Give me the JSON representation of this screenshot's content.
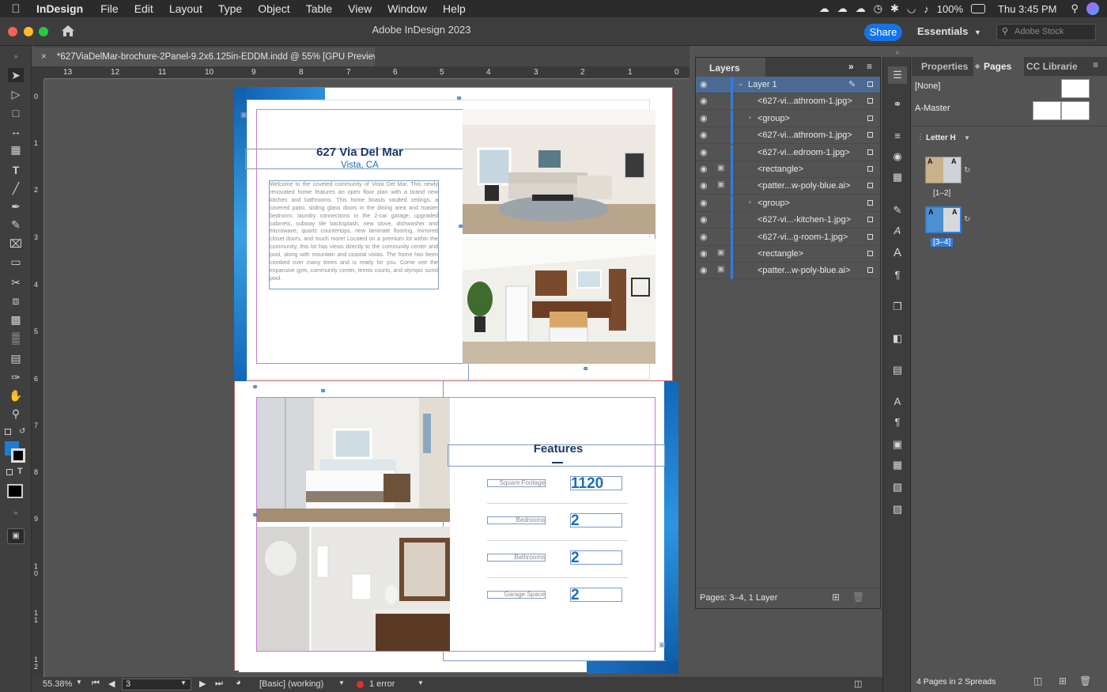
{
  "menubar": {
    "app_name": "InDesign",
    "items": [
      "File",
      "Edit",
      "Layout",
      "Type",
      "Object",
      "Table",
      "View",
      "Window",
      "Help"
    ],
    "battery": "100%",
    "clock": "Thu 3:45 PM"
  },
  "appbar": {
    "title": "Adobe InDesign 2023",
    "share_label": "Share",
    "workspace": "Essentials",
    "stock_placeholder": "Adobe Stock"
  },
  "document": {
    "tab_title": "*627ViaDelMar-brochure-2Panel-9.2x6.125in-EDDM.indd @ 55% [GPU Preview]",
    "close_glyph": "×"
  },
  "rulers": {
    "horizontal": [
      "13",
      "12",
      "11",
      "10",
      "9",
      "8",
      "7",
      "6",
      "5",
      "4",
      "3",
      "2",
      "1",
      "0"
    ],
    "vertical": [
      "0",
      "1",
      "2",
      "3",
      "4",
      "5",
      "6",
      "7",
      "8",
      "9",
      "1 0",
      "1 1",
      "1 2"
    ]
  },
  "brochure": {
    "title": "627 Via Del Mar",
    "subtitle": "Vista, CA",
    "body": "Welcome to the coveted community of Vista Del Mar. This newly renovated home features an open floor plan with a brand new kitchen and bathrooms. This home boasts vaulted ceilings, a covered patio, sliding glass doors in the dining area and master bedroom, laundry connections in the 2-car garage, upgraded cabinets, subway tile backsplash, new stove, dishwasher and microwave, quartz countertops, new laminate flooring, mirrored closet doors, and much more! Located on a premium lot within the community, this lot has views directly to the community center and pool, along with mountain and coastal vistas. The home has been combed over many times and is ready for you. Come see the expansive gym, community center, tennis courts, and olympic sized pool.",
    "features_title": "Features",
    "features": [
      {
        "label": "Square Footage",
        "value": "1120"
      },
      {
        "label": "Bedrooms",
        "value": "2"
      },
      {
        "label": "Bathrooms",
        "value": "2"
      },
      {
        "label": "Garage Space",
        "value": "2"
      }
    ]
  },
  "status": {
    "zoom": "55.38%",
    "page": "3",
    "style": "[Basic] (working)",
    "errors": "1 error"
  },
  "layers_panel": {
    "tab": "Layers",
    "rows": [
      "Layer 1",
      "<627-vi...athroom-1.jpg>",
      "<group>",
      "<627-vi...athroom-1.jpg>",
      "<627-vi...edroom-1.jpg>",
      "<rectangle>",
      "<patter...w-poly-blue.ai>",
      "<group>",
      "<627-vi...-kitchen-1.jpg>",
      "<627-vi...g-room-1.jpg>",
      "<rectangle>",
      "<patter...w-poly-blue.ai>"
    ],
    "footer": "Pages: 3–4, 1 Layer"
  },
  "pages_panel": {
    "tabs": [
      "Properties",
      "Pages",
      "CC Librarie"
    ],
    "masters": [
      "[None]",
      "A-Master"
    ],
    "size_label": "Letter H",
    "spreads": [
      "[1–2]",
      "[3–4]"
    ],
    "page_letter": "A",
    "footer": "4 Pages in 2 Spreads"
  },
  "colors": {
    "accent": "#1473e6",
    "brochure_navy": "#1d3a66",
    "brochure_blue": "#1a6fb8",
    "selected_row": "#4a6a94"
  }
}
